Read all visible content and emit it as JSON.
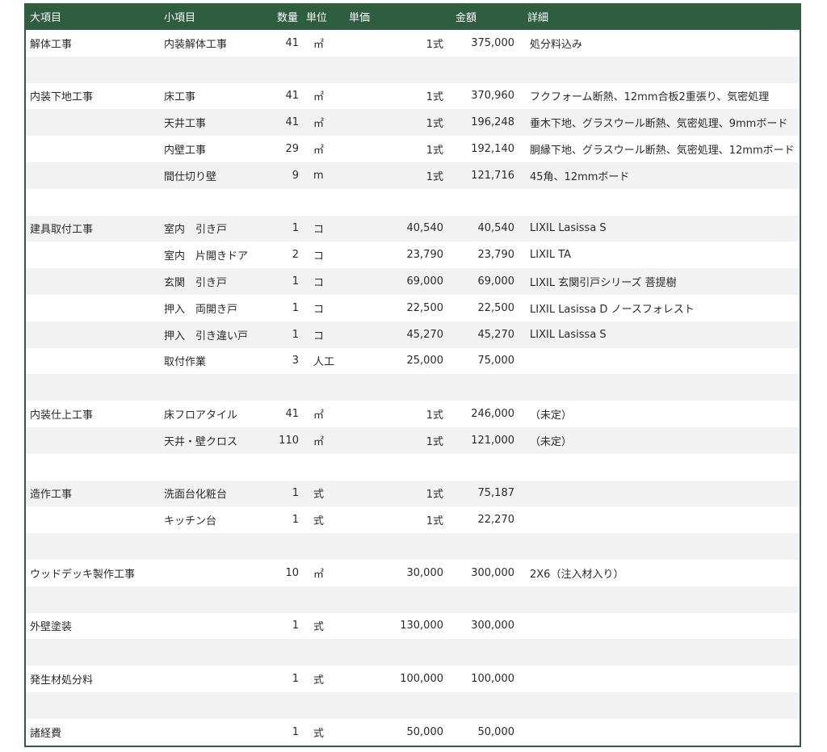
{
  "colors": {
    "header_bg": "#2e5d40",
    "header_text": "#ffffff",
    "row_alt": "#f2f2f2",
    "text": "#2a2a2a"
  },
  "headers": {
    "major": "大項目",
    "minor": "小項目",
    "qty": "数量",
    "unit": "単位",
    "price": "単価",
    "amount": "金額",
    "detail": "詳細"
  },
  "rows": [
    {
      "major": "解体工事",
      "minor": "内装解体工事",
      "qty": "41",
      "unit": "㎡",
      "price": "1式",
      "amount": "375,000",
      "detail": "処分料込み"
    },
    {
      "major": "",
      "minor": "",
      "qty": "",
      "unit": "",
      "price": "",
      "amount": "",
      "detail": ""
    },
    {
      "major": "内装下地工事",
      "minor": "床工事",
      "qty": "41",
      "unit": "㎡",
      "price": "1式",
      "amount": "370,960",
      "detail": "フクフォーム断熱、12mm合板2重張り、気密処理"
    },
    {
      "major": "",
      "minor": "天井工事",
      "qty": "41",
      "unit": "㎡",
      "price": "1式",
      "amount": "196,248",
      "detail": "垂木下地、グラスウール断熱、気密処理、9mmボード"
    },
    {
      "major": "",
      "minor": "内壁工事",
      "qty": "29",
      "unit": "㎡",
      "price": "1式",
      "amount": "192,140",
      "detail": "胴縁下地、グラスウール断熱、気密処理、12mmボード"
    },
    {
      "major": "",
      "minor": "間仕切り壁",
      "qty": "9",
      "unit": "m",
      "price": "1式",
      "amount": "121,716",
      "detail": "45角、12mmボード"
    },
    {
      "major": "",
      "minor": "",
      "qty": "",
      "unit": "",
      "price": "",
      "amount": "",
      "detail": ""
    },
    {
      "major": "建具取付工事",
      "minor": "室内　引き戸",
      "qty": "1",
      "unit": "コ",
      "price": "40,540",
      "amount": "40,540",
      "detail": "LIXIL Lasissa S"
    },
    {
      "major": "",
      "minor": "室内　片開きドア",
      "qty": "2",
      "unit": "コ",
      "price": "23,790",
      "amount": "23,790",
      "detail": "LIXIL TA"
    },
    {
      "major": "",
      "minor": "玄関　引き戸",
      "qty": "1",
      "unit": "コ",
      "price": "69,000",
      "amount": "69,000",
      "detail": "LIXIL 玄関引戸シリーズ 菩提樹"
    },
    {
      "major": "",
      "minor": "押入　両開き戸",
      "qty": "1",
      "unit": "コ",
      "price": "22,500",
      "amount": "22,500",
      "detail": "LIXIL Lasissa D ノースフォレスト"
    },
    {
      "major": "",
      "minor": "押入　引き違い戸",
      "qty": "1",
      "unit": "コ",
      "price": "45,270",
      "amount": "45,270",
      "detail": "LIXIL Lasissa S"
    },
    {
      "major": "",
      "minor": "取付作業",
      "qty": "3",
      "unit": "人工",
      "price": "25,000",
      "amount": "75,000",
      "detail": ""
    },
    {
      "major": "",
      "minor": "",
      "qty": "",
      "unit": "",
      "price": "",
      "amount": "",
      "detail": ""
    },
    {
      "major": "内装仕上工事",
      "minor": "床フロアタイル",
      "qty": "41",
      "unit": "㎡",
      "price": "1式",
      "amount": "246,000",
      "detail": "（未定）"
    },
    {
      "major": "",
      "minor": "天井・壁クロス",
      "qty": "110",
      "unit": "㎡",
      "price": "1式",
      "amount": "121,000",
      "detail": "（未定）"
    },
    {
      "major": "",
      "minor": "",
      "qty": "",
      "unit": "",
      "price": "",
      "amount": "",
      "detail": ""
    },
    {
      "major": "造作工事",
      "minor": "洗面台化粧台",
      "qty": "1",
      "unit": "式",
      "price": "1式",
      "amount": "75,187",
      "detail": ""
    },
    {
      "major": "",
      "minor": "キッチン台",
      "qty": "1",
      "unit": "式",
      "price": "1式",
      "amount": "22,270",
      "detail": ""
    },
    {
      "major": "",
      "minor": "",
      "qty": "",
      "unit": "",
      "price": "",
      "amount": "",
      "detail": ""
    },
    {
      "major": "ウッドデッキ製作工事",
      "minor": "",
      "qty": "10",
      "unit": "㎡",
      "price": "30,000",
      "amount": "300,000",
      "detail": "2X6（注入材入り）"
    },
    {
      "major": "",
      "minor": "",
      "qty": "",
      "unit": "",
      "price": "",
      "amount": "",
      "detail": ""
    },
    {
      "major": "外壁塗装",
      "minor": "",
      "qty": "1",
      "unit": "式",
      "price": "130,000",
      "amount": "300,000",
      "detail": ""
    },
    {
      "major": "",
      "minor": "",
      "qty": "",
      "unit": "",
      "price": "",
      "amount": "",
      "detail": ""
    },
    {
      "major": "発生材処分料",
      "minor": "",
      "qty": "1",
      "unit": "式",
      "price": "100,000",
      "amount": "100,000",
      "detail": ""
    },
    {
      "major": "",
      "minor": "",
      "qty": "",
      "unit": "",
      "price": "",
      "amount": "",
      "detail": ""
    },
    {
      "major": "諸経費",
      "minor": "",
      "qty": "1",
      "unit": "式",
      "price": "50,000",
      "amount": "50,000",
      "detail": ""
    }
  ]
}
